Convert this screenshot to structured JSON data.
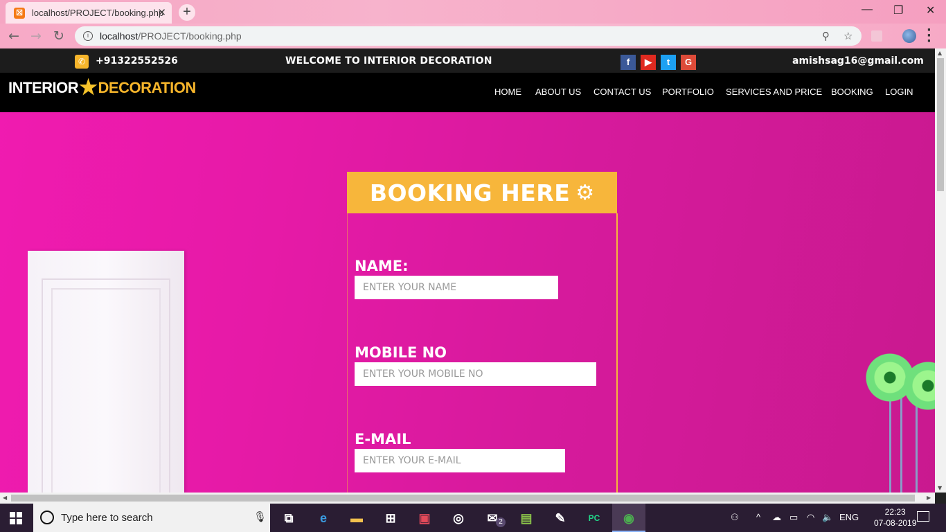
{
  "browser": {
    "tab_title": "localhost/PROJECT/booking.php",
    "tab_close": "✕",
    "new_tab": "+",
    "url_host": "localhost",
    "url_path": "/PROJECT/booking.php",
    "favicon_letter": "☒"
  },
  "topbar": {
    "phone": "+91322552526",
    "welcome": "WELCOME TO INTERIOR DECORATION",
    "email": "amishsag16@gmail.com",
    "social": [
      {
        "icon": "facebook-icon",
        "glyph": "f",
        "color": "#3b5998"
      },
      {
        "icon": "youtube-icon",
        "glyph": "▶",
        "color": "#e02a20"
      },
      {
        "icon": "twitter-icon",
        "glyph": "t",
        "color": "#1da1f2"
      },
      {
        "icon": "google-icon",
        "glyph": "G",
        "color": "#dd4b39"
      }
    ]
  },
  "logo": {
    "part1": "INTERIOR",
    "part2": "DECORATION"
  },
  "nav": [
    "HOME",
    "ABOUT US",
    "CONTACT US",
    "PORTFOLIO",
    "SERVICES AND PRICE",
    "BOOKING",
    "LOGIN"
  ],
  "booking": {
    "title": "BOOKING HERE",
    "fields": [
      {
        "label": "NAME:",
        "placeholder": "ENTER YOUR NAME"
      },
      {
        "label": "MOBILE NO",
        "placeholder": "ENTER YOUR MOBILE NO"
      },
      {
        "label": "E-MAIL",
        "placeholder": "ENTER YOUR E-MAIL"
      }
    ]
  },
  "taskbar": {
    "search_placeholder": "Type here to search",
    "language": "ENG",
    "time": "22:23",
    "date": "07-08-2019",
    "mail_badge": "2"
  },
  "colors": {
    "accent": "#f7b63b",
    "page_bg": "#e61aa7",
    "nav_bg": "#000000"
  }
}
